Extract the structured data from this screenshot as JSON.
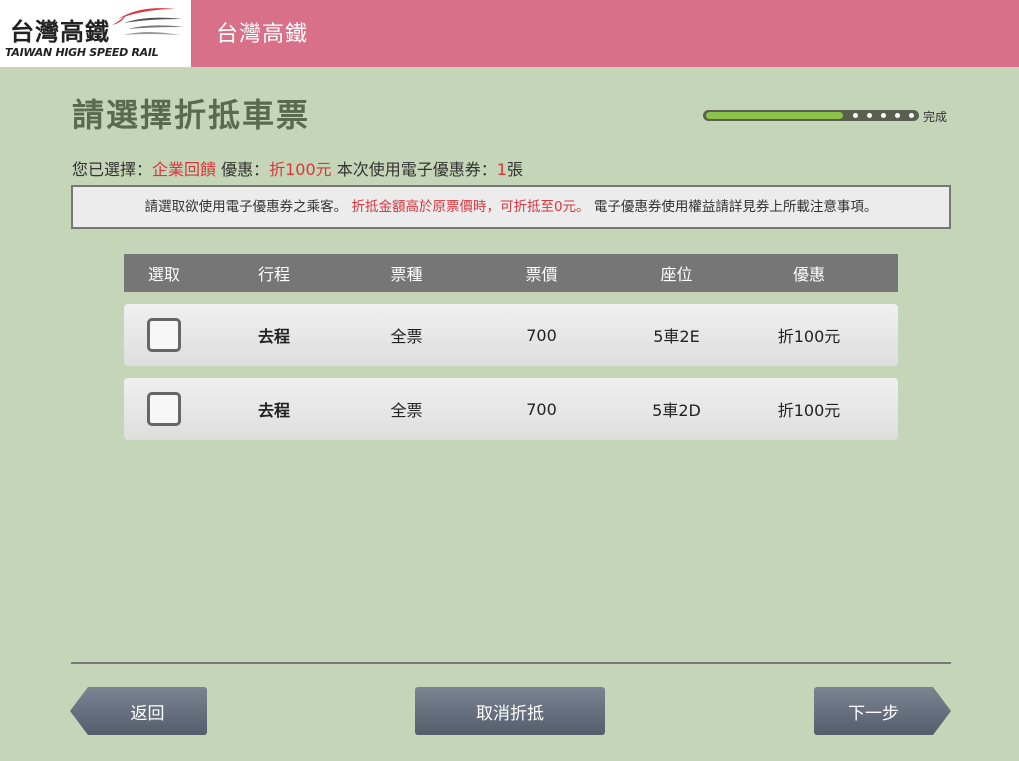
{
  "header": {
    "logo_cn": "台灣高鐵",
    "logo_en": "TAIWAN HIGH SPEED RAIL",
    "title": "台灣高鐵",
    "bar_color": "#d9708a"
  },
  "page": {
    "title": "請選擇折抵車票",
    "progress": {
      "label": "完成",
      "fraction": 0.65,
      "remaining_steps": 5
    }
  },
  "selection": {
    "prefix": "您已選擇：",
    "program": "企業回饋",
    "discount_label": " 優惠：",
    "discount": "折100元",
    "coupon_label": " 本次使用電子優惠券：",
    "coupon_count": "1",
    "coupon_unit": "張"
  },
  "notice": {
    "part1": "請選取欲使用電子優惠券之乘客。",
    "part2": "折抵金額高於原票價時，可折抵至0元。",
    "part3": "電子優惠券使用權益請詳見券上所載注意事項。"
  },
  "table": {
    "headers": [
      "選取",
      "行程",
      "票種",
      "票價",
      "座位",
      "優惠"
    ],
    "rows": [
      {
        "trip": "去程",
        "ticket_type": "全票",
        "price": "700",
        "seat": "5車2E",
        "discount": "折100元",
        "checked": false
      },
      {
        "trip": "去程",
        "ticket_type": "全票",
        "price": "700",
        "seat": "5車2D",
        "discount": "折100元",
        "checked": false
      }
    ]
  },
  "buttons": {
    "back": "返回",
    "cancel": "取消折抵",
    "next": "下一步"
  }
}
